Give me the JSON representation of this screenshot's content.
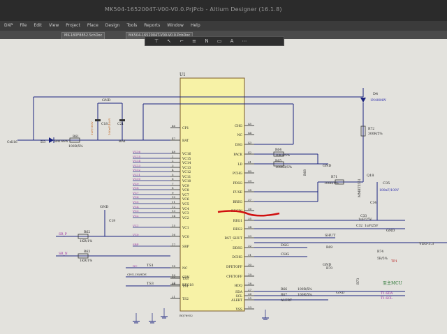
{
  "window": {
    "title": "MK504-1652004T-V00-V0.0.PrjPcb - Altium Designer (16.1.8)",
    "menu": [
      "DXP",
      "File",
      "Edit",
      "View",
      "Project",
      "Place",
      "Design",
      "Tools",
      "Reports",
      "Window",
      "Help"
    ],
    "tabs": [
      "MK-180F8852.SchDoc",
      "MK504-1652004T-V00-V0.0.PcbDoc"
    ],
    "toolbar_icons": [
      "filter-icon",
      "pointer-icon",
      "wire-icon",
      "bus-icon",
      "netlabel-icon",
      "port-icon",
      "text-icon",
      "more-icon"
    ]
  },
  "schematic": {
    "chip": {
      "designator": "U1",
      "part": "BQ76952",
      "left_pins": [
        {
          "num": "46",
          "name": "CP1"
        },
        {
          "num": "47",
          "name": "BAT"
        },
        {
          "num": "48",
          "name": "VC16"
        },
        {
          "num": "1",
          "name": "VC15"
        },
        {
          "num": "2",
          "name": "VC14"
        },
        {
          "num": "3",
          "name": "VC13"
        },
        {
          "num": "4",
          "name": "VC12"
        },
        {
          "num": "5",
          "name": "VC11"
        },
        {
          "num": "6",
          "name": "VC10"
        },
        {
          "num": "7",
          "name": "VC9"
        },
        {
          "num": "8",
          "name": "VC8"
        },
        {
          "num": "9",
          "name": "VC7"
        },
        {
          "num": "10",
          "name": "VC6"
        },
        {
          "num": "11",
          "name": "VC5"
        },
        {
          "num": "12",
          "name": "VC4"
        },
        {
          "num": "13",
          "name": "VC3"
        },
        {
          "num": "14",
          "name": "VC2"
        },
        {
          "num": "15",
          "name": "VC1"
        },
        {
          "num": "16",
          "name": "VC0"
        },
        {
          "num": "17",
          "name": "SRP"
        },
        {
          "num": "18",
          "name": "NC"
        },
        {
          "num": "19",
          "name": "SRN"
        },
        {
          "num": "20",
          "name": "TS1"
        },
        {
          "num": "21",
          "name": "TS2"
        },
        {
          "num": "22",
          "name": "TS3"
        },
        {
          "num": "24",
          "name": "REG18"
        }
      ],
      "right_pins": [
        {
          "num": "45",
          "name": "CHG"
        },
        {
          "num": "44",
          "name": "NC"
        },
        {
          "num": "43",
          "name": "DSG"
        },
        {
          "num": "42",
          "name": "PACK"
        },
        {
          "num": "41",
          "name": "LD"
        },
        {
          "num": "40",
          "name": "PCHG"
        },
        {
          "num": "39",
          "name": "PDSG"
        },
        {
          "num": "38",
          "name": "FUSE"
        },
        {
          "num": "37",
          "name": "BREG"
        },
        {
          "num": "36",
          "name": "REGIN"
        },
        {
          "num": "35",
          "name": "REG1"
        },
        {
          "num": "34",
          "name": "REG2"
        },
        {
          "num": "33",
          "name": "RST_SHUT"
        },
        {
          "num": "32",
          "name": "DDSG"
        },
        {
          "num": "31",
          "name": "DCHG"
        },
        {
          "num": "30",
          "name": "DFETOFF"
        },
        {
          "num": "29",
          "name": "CFETOFF"
        },
        {
          "num": "28",
          "name": "HDQ"
        },
        {
          "num": "27",
          "name": "SDA"
        },
        {
          "num": "26",
          "name": "SCL"
        },
        {
          "num": "25",
          "name": "ALERT"
        },
        {
          "num": "23",
          "name": "VSS"
        }
      ]
    },
    "labels": {
      "cells": "Cell16",
      "d3": "D3",
      "d3_part": "BAT46W",
      "r61": "R61",
      "r61_val": "100R/5%",
      "c18": "C18",
      "c21": "C21",
      "c18_val": "1uF/100V",
      "c21_val": "100nF/100V",
      "gnd": "GND",
      "bat": "BAT",
      "d4": "D4",
      "d4_part": "1N4004W",
      "r72": "R72",
      "r72_val": "300R/5%",
      "r64": "R64",
      "r64_val": "10KR/5%",
      "r65": "R65",
      "r65_val": "100KR/5%",
      "r68": "R68",
      "r71": "R71",
      "r71_val": "100R/5%",
      "q18": "Q18",
      "q18_part": "MMBT5551",
      "c35": "C35",
      "c35_val": "100nF/100V",
      "c34": "C34",
      "c33": "C33",
      "c33_val": "1uF/25V",
      "c32": "C32",
      "c32_val": "1uF/25V",
      "vdo": "VDD-3.3",
      "c19": "C19",
      "sr_p": "SR_P",
      "sr_n": "SR_N",
      "r62": "R62",
      "r62_val": "1KR/1%",
      "r63": "R63",
      "r63_val": "1KR/1%",
      "shut": "SHUT",
      "dsg": "DSG",
      "chg": "CHG",
      "r69": "R69",
      "r70": "R70",
      "r73": "R73",
      "r74": "R74",
      "r74_val": "5R/5%",
      "tp1": "TP1",
      "mcu": "至主MCU",
      "r66": "R66",
      "r66_val": "100R/5%",
      "r67": "R67",
      "r67_val": "100R/5%",
      "t1_sda": "T1-SDA",
      "t1_scl": "T1-SCL",
      "alert": "ALERT",
      "ts1": "TS1",
      "chg_in": "CHG_IN/HDE",
      "ts3": "TS3"
    }
  }
}
